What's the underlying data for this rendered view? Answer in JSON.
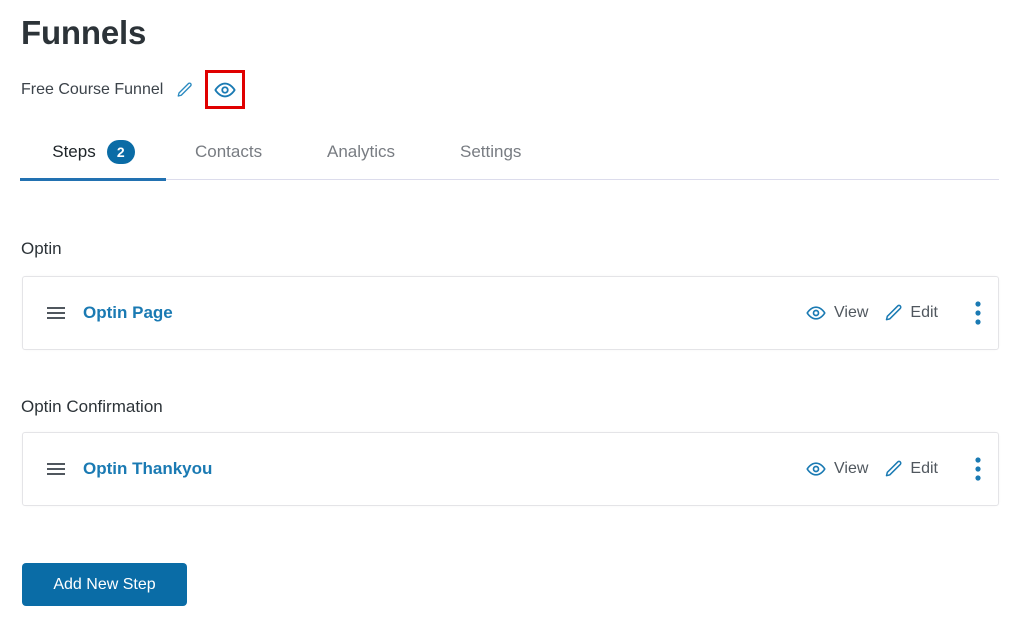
{
  "header": {
    "title": "Funnels",
    "funnel_name": "Free Course Funnel"
  },
  "tabs": [
    {
      "label": "Steps",
      "badge": "2",
      "active": true
    },
    {
      "label": "Contacts",
      "active": false
    },
    {
      "label": "Analytics",
      "active": false
    },
    {
      "label": "Settings",
      "active": false
    }
  ],
  "groups": [
    {
      "label": "Optin",
      "steps": [
        {
          "title": "Optin Page",
          "view_label": "View",
          "edit_label": "Edit"
        }
      ]
    },
    {
      "label": "Optin Confirmation",
      "steps": [
        {
          "title": "Optin Thankyou",
          "view_label": "View",
          "edit_label": "Edit"
        }
      ]
    }
  ],
  "actions": {
    "add_step_label": "Add New Step"
  },
  "colors": {
    "accent": "#0a6ca6",
    "link": "#1a7ab3",
    "highlight": "#e00000"
  }
}
